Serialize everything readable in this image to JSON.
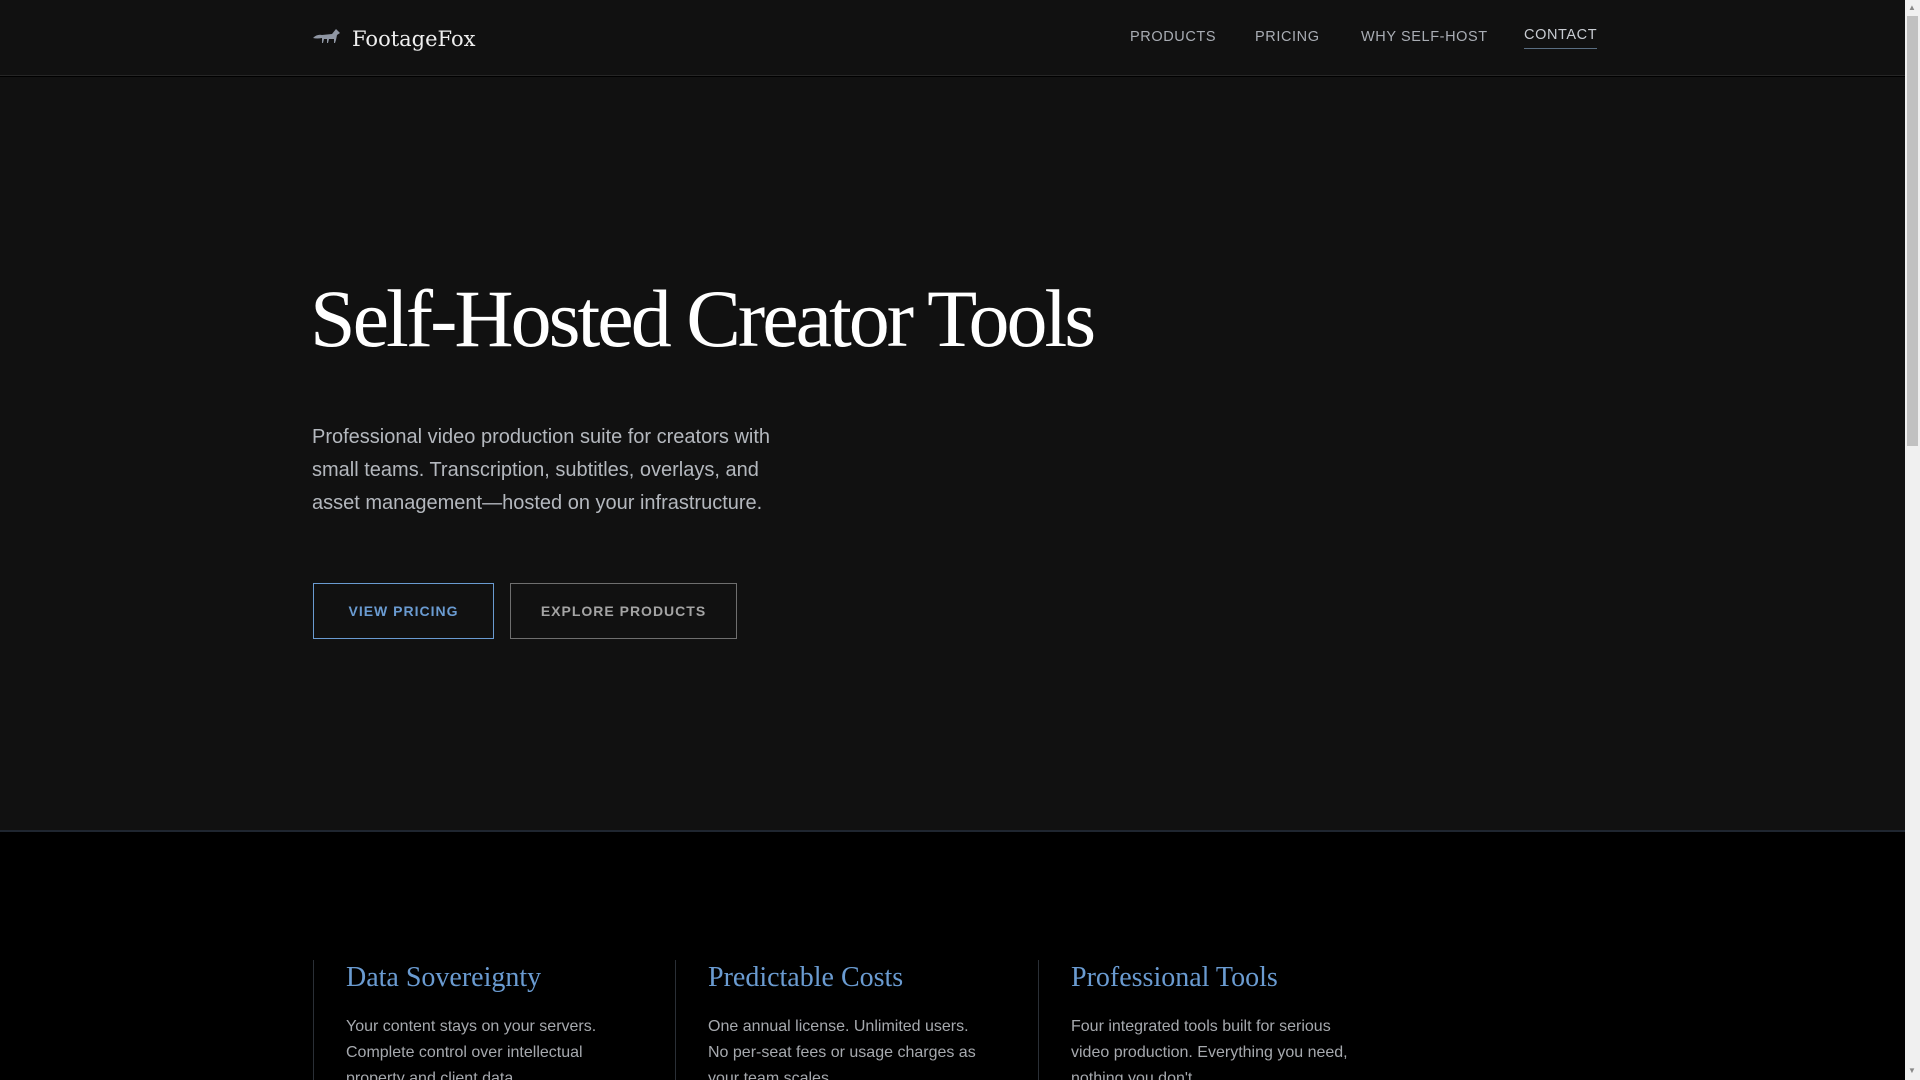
{
  "header": {
    "brand": "FootageFox",
    "nav": [
      {
        "label": "PRODUCTS"
      },
      {
        "label": "PRICING"
      },
      {
        "label": "WHY SELF-HOST"
      },
      {
        "label": "CONTACT",
        "active": true
      }
    ]
  },
  "hero": {
    "title": "Self-Hosted Creator Tools",
    "lead": "Professional video production suite for creators with small teams. Transcription, subtitles, overlays, and asset management—hosted on your infrastructure.",
    "primary_button": "VIEW PRICING",
    "secondary_button": "EXPLORE PRODUCTS"
  },
  "features": [
    {
      "title": "Data Sovereignty",
      "text": "Your content stays on your servers. Complete control over intellectual property and client data."
    },
    {
      "title": "Predictable Costs",
      "text": "One annual license. Unlimited users. No per-seat fees or usage charges as your team scales."
    },
    {
      "title": "Professional Tools",
      "text": "Four integrated tools built for serious video production. Everything you need, nothing you don't."
    }
  ],
  "colors": {
    "accent": "#6a9bd1",
    "hero_bg": "#111111",
    "section_bg": "#000000"
  }
}
